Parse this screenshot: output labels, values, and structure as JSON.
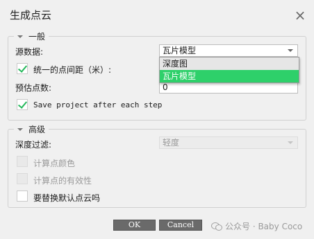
{
  "dialog": {
    "title": "生成点云",
    "close_icon": "×"
  },
  "general": {
    "legend": "一般",
    "source_label": "源数据:",
    "source_value": "瓦片模型",
    "source_options": [
      "深度图",
      "瓦片模型"
    ],
    "uniform_spacing_label": "统一的点间距（米）:",
    "uniform_spacing_checked": true,
    "estimate_label": "预估点数:",
    "estimate_value": "0",
    "save_project_label": "Save project after each step",
    "save_project_checked": true
  },
  "advanced": {
    "legend": "高级",
    "depth_filter_label": "深度过滤:",
    "depth_filter_value": "轻度",
    "compute_color_label": "计算点颜色",
    "compute_validity_label": "计算点的有效性",
    "replace_default_label": "要替换默认点云吗",
    "replace_default_checked": false
  },
  "buttons": {
    "ok": "OK",
    "cancel": "Cancel"
  },
  "watermark": {
    "text": "公众号 · Baby Coco"
  },
  "colors": {
    "accent": "#2ed06a",
    "check": "#23b85a",
    "button": "#6a6a6a"
  }
}
